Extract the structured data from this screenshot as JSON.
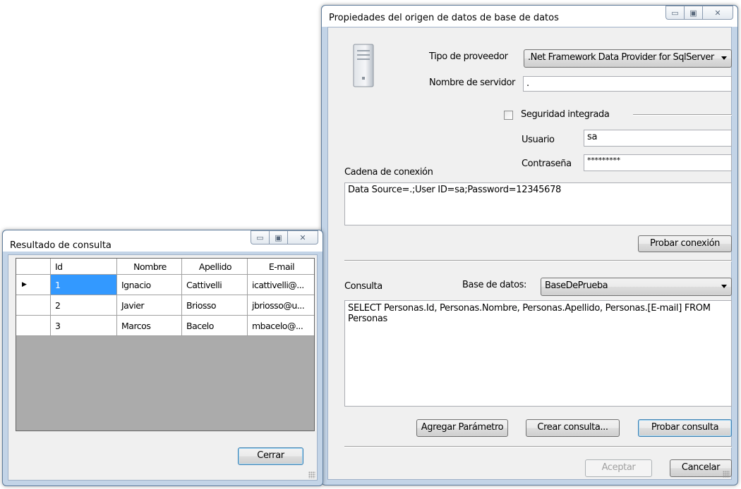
{
  "props_window": {
    "title": "Propiedades del origen de datos de base de datos",
    "labels": {
      "provider": "Tipo de proveedor",
      "server": "Nombre de servidor",
      "integrated": "Seguridad integrada",
      "user": "Usuario",
      "password": "Contraseña",
      "connection_string": "Cadena de conexión",
      "query": "Consulta",
      "database": "Base de datos:"
    },
    "provider_value": ".Net Framework Data Provider for SqlServer",
    "server_value": ".",
    "integrated_checked": false,
    "user_value": "sa",
    "password_value": "*********",
    "connection_string_value": "Data Source=.;User ID=sa;Password=12345678",
    "database_value": "BaseDePrueba",
    "query_value": "SELECT Personas.Id, Personas.Nombre, Personas.Apellido, Personas.[E-mail] FROM Personas",
    "buttons": {
      "test_connection": "Probar conexión",
      "add_parameter": "Agregar Parámetro",
      "create_query": "Crear consulta...",
      "test_query": "Probar consulta",
      "accept": "Aceptar",
      "cancel": "Cancelar"
    },
    "icon": "server-tower-icon"
  },
  "result_window": {
    "title": "Resultado de consulta",
    "columns": [
      "Id",
      "Nombre",
      "Apellido",
      "E-mail"
    ],
    "rows": [
      [
        "1",
        "Ignacio",
        "Cattivelli",
        "icattivelli@..."
      ],
      [
        "2",
        "Javier",
        "Briosso",
        "jbriosso@u..."
      ],
      [
        "3",
        "Marcos",
        "Bacelo",
        "mbacelo@..."
      ]
    ],
    "current_row_marker": "▶",
    "close_button": "Cerrar"
  },
  "caption": {
    "minimize": "▭",
    "maximize": "▣",
    "close": "✕"
  },
  "colors": {
    "selection": "#3399ff",
    "grid_background": "#ababab",
    "window_frame": "#c3d4e7"
  }
}
